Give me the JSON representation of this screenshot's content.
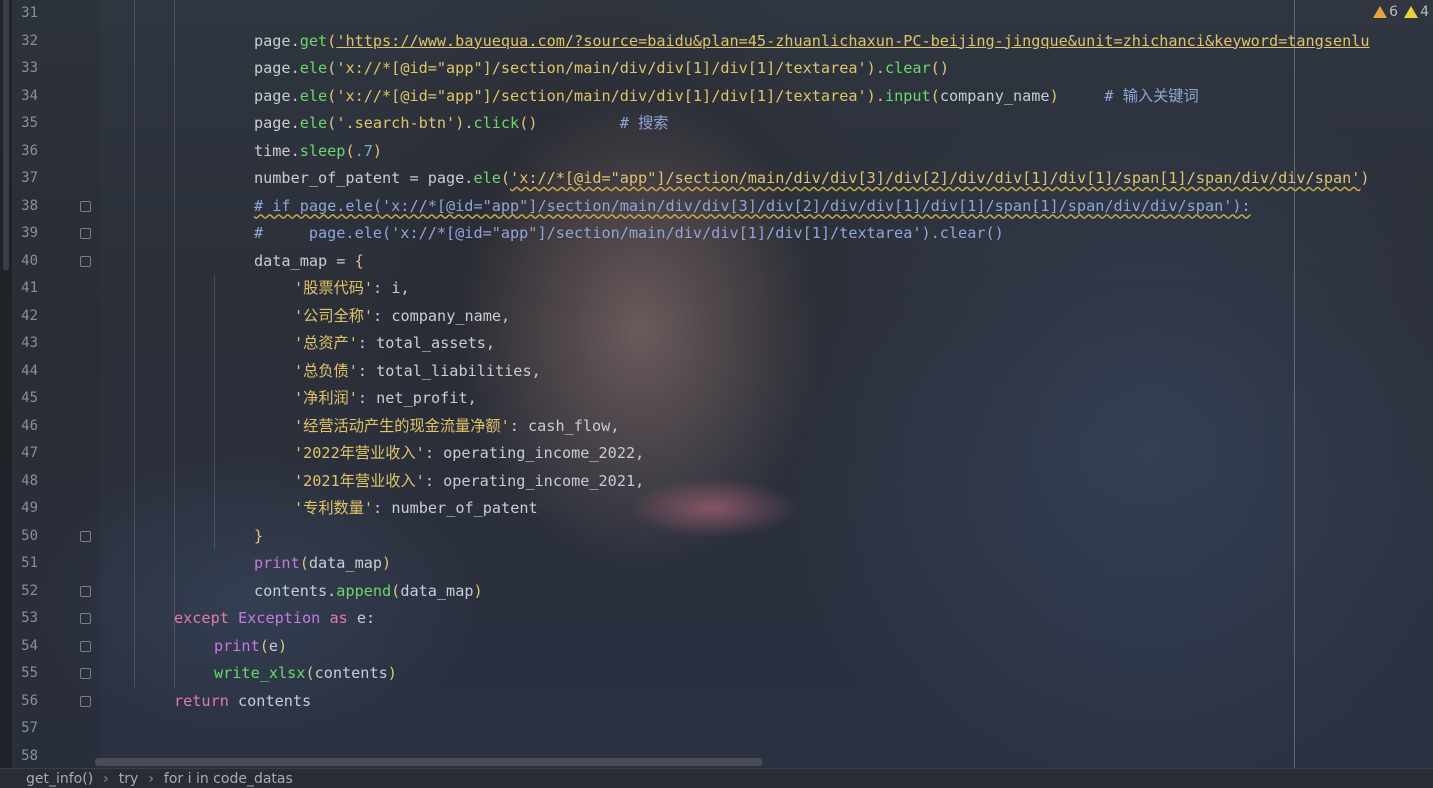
{
  "editor": {
    "warnings": {
      "warning_count": "6",
      "weak_warning_count": "4"
    },
    "lines": [
      {
        "num": "31",
        "indent": 0,
        "tokens": []
      },
      {
        "num": "32",
        "indent": 3,
        "tokens": [
          {
            "t": "page.",
            "c": "hs"
          },
          {
            "t": "get",
            "c": "m"
          },
          {
            "t": "(",
            "c": "p"
          },
          {
            "t": "'https://www.bayuequa.com/?source=baidu&plan=45-zhuanlichaxun-PC-beijing-jingque&unit=zhichanci&keyword=tangsenlu",
            "c": "s u"
          }
        ]
      },
      {
        "num": "33",
        "indent": 3,
        "tokens": [
          {
            "t": "page.",
            "c": "hs"
          },
          {
            "t": "ele",
            "c": "m"
          },
          {
            "t": "(",
            "c": "p"
          },
          {
            "t": "'x://*[@id=\"app\"]/section/main/div/div[1]/div[1]/textarea'",
            "c": "s"
          },
          {
            "t": ").",
            "c": "p"
          },
          {
            "t": "clear",
            "c": "m"
          },
          {
            "t": "()",
            "c": "p"
          }
        ]
      },
      {
        "num": "34",
        "indent": 3,
        "tokens": [
          {
            "t": "page.",
            "c": "hs"
          },
          {
            "t": "ele",
            "c": "m"
          },
          {
            "t": "(",
            "c": "p"
          },
          {
            "t": "'x://*[@id=\"app\"]/section/main/div/div[1]/div[1]/textarea'",
            "c": "s"
          },
          {
            "t": ").",
            "c": "p"
          },
          {
            "t": "input",
            "c": "m"
          },
          {
            "t": "(",
            "c": "p"
          },
          {
            "t": "company_name",
            "c": "hs"
          },
          {
            "t": ")",
            "c": "p"
          },
          {
            "t": "     # 输入关键词",
            "c": "cm"
          }
        ]
      },
      {
        "num": "35",
        "indent": 3,
        "tokens": [
          {
            "t": "page.",
            "c": "hs"
          },
          {
            "t": "ele",
            "c": "m"
          },
          {
            "t": "(",
            "c": "p"
          },
          {
            "t": "'.search-btn'",
            "c": "s"
          },
          {
            "t": ").",
            "c": "p"
          },
          {
            "t": "click",
            "c": "m"
          },
          {
            "t": "()",
            "c": "p"
          },
          {
            "t": "         # 搜索",
            "c": "cm"
          }
        ]
      },
      {
        "num": "36",
        "indent": 3,
        "tokens": [
          {
            "t": "time.",
            "c": "hs"
          },
          {
            "t": "sleep",
            "c": "m"
          },
          {
            "t": "(",
            "c": "p"
          },
          {
            "t": ".7",
            "c": "n"
          },
          {
            "t": ")",
            "c": "p"
          }
        ]
      },
      {
        "num": "37",
        "indent": 3,
        "tokens": [
          {
            "t": "number_of_patent = page.",
            "c": "hs"
          },
          {
            "t": "ele",
            "c": "m"
          },
          {
            "t": "(",
            "c": "p"
          },
          {
            "t": "'x://*[@id=\"app\"]/section/main/div/div[3]/div[2]/div/div[1]/div[1]/span[1]/span/div/div/span'",
            "c": "s uw"
          },
          {
            "t": ")",
            "c": "p"
          }
        ]
      },
      {
        "num": "38",
        "indent": 3,
        "tokens": [
          {
            "t": "# if page.ele('x://*[@id=\"app\"]/section/main/div/div[3]/div[2]/div/div[1]/div[1]/span[1]/span/div/div/span'):",
            "c": "cm uw"
          }
        ]
      },
      {
        "num": "39",
        "indent": 3,
        "tokens": [
          {
            "t": "#     page.ele('x://*[@id=\"app\"]/section/main/div/div[1]/div[1]/textarea').clear()",
            "c": "cm"
          }
        ]
      },
      {
        "num": "40",
        "indent": 3,
        "tokens": [
          {
            "t": "data_map = ",
            "c": "hs"
          },
          {
            "t": "{",
            "c": "p"
          }
        ]
      },
      {
        "num": "41",
        "indent": 4,
        "tokens": [
          {
            "t": "'股票代码'",
            "c": "s"
          },
          {
            "t": ": i,",
            "c": "hs"
          }
        ]
      },
      {
        "num": "42",
        "indent": 4,
        "tokens": [
          {
            "t": "'公司全称'",
            "c": "s"
          },
          {
            "t": ": company_name,",
            "c": "hs"
          }
        ]
      },
      {
        "num": "43",
        "indent": 4,
        "tokens": [
          {
            "t": "'总资产'",
            "c": "s"
          },
          {
            "t": ": total_assets,",
            "c": "hs"
          }
        ]
      },
      {
        "num": "44",
        "indent": 4,
        "tokens": [
          {
            "t": "'总负债'",
            "c": "s"
          },
          {
            "t": ": total_liabilities,",
            "c": "hs"
          }
        ]
      },
      {
        "num": "45",
        "indent": 4,
        "tokens": [
          {
            "t": "'净利润'",
            "c": "s"
          },
          {
            "t": ": net_profit,",
            "c": "hs"
          }
        ]
      },
      {
        "num": "46",
        "indent": 4,
        "tokens": [
          {
            "t": "'经营活动产生的现金流量净额'",
            "c": "s"
          },
          {
            "t": ": cash_flow,",
            "c": "hs"
          }
        ]
      },
      {
        "num": "47",
        "indent": 4,
        "tokens": [
          {
            "t": "'2022年营业收入'",
            "c": "s"
          },
          {
            "t": ": operating_income_2022,",
            "c": "hs"
          }
        ]
      },
      {
        "num": "48",
        "indent": 4,
        "tokens": [
          {
            "t": "'2021年营业收入'",
            "c": "s"
          },
          {
            "t": ": operating_income_2021,",
            "c": "hs"
          }
        ]
      },
      {
        "num": "49",
        "indent": 4,
        "tokens": [
          {
            "t": "'专利数量'",
            "c": "s"
          },
          {
            "t": ": number_of_patent",
            "c": "hs"
          }
        ]
      },
      {
        "num": "50",
        "indent": 3,
        "tokens": [
          {
            "t": "}",
            "c": "p"
          }
        ]
      },
      {
        "num": "51",
        "indent": 3,
        "tokens": [
          {
            "t": "print",
            "c": "f"
          },
          {
            "t": "(",
            "c": "p"
          },
          {
            "t": "data_map",
            "c": "hs"
          },
          {
            "t": ")",
            "c": "p"
          }
        ]
      },
      {
        "num": "52",
        "indent": 3,
        "tokens": [
          {
            "t": "contents.",
            "c": "hs"
          },
          {
            "t": "append",
            "c": "m"
          },
          {
            "t": "(",
            "c": "p"
          },
          {
            "t": "data_map",
            "c": "hs"
          },
          {
            "t": ")",
            "c": "p"
          }
        ]
      },
      {
        "num": "53",
        "indent": 1,
        "tokens": [
          {
            "t": "except ",
            "c": "k"
          },
          {
            "t": "Exception ",
            "c": "f"
          },
          {
            "t": "as ",
            "c": "k"
          },
          {
            "t": "e:",
            "c": "hs"
          }
        ]
      },
      {
        "num": "54",
        "indent": 2,
        "tokens": [
          {
            "t": "print",
            "c": "f"
          },
          {
            "t": "(",
            "c": "p"
          },
          {
            "t": "e",
            "c": "hs"
          },
          {
            "t": ")",
            "c": "p"
          }
        ]
      },
      {
        "num": "55",
        "indent": 2,
        "tokens": [
          {
            "t": "write_xlsx",
            "c": "m"
          },
          {
            "t": "(",
            "c": "p"
          },
          {
            "t": "contents",
            "c": "hs"
          },
          {
            "t": ")",
            "c": "p"
          }
        ]
      },
      {
        "num": "56",
        "indent": 1,
        "tokens": [
          {
            "t": "return ",
            "c": "k"
          },
          {
            "t": "contents",
            "c": "hs"
          }
        ]
      },
      {
        "num": "57",
        "indent": 0,
        "tokens": []
      },
      {
        "num": "58",
        "indent": 0,
        "tokens": []
      }
    ],
    "folds": [
      "38",
      "39",
      "40",
      "50",
      "52",
      "53",
      "54",
      "55",
      "56"
    ]
  },
  "breadcrumb": [
    "get_info()",
    "try",
    "for i in code_datas"
  ]
}
